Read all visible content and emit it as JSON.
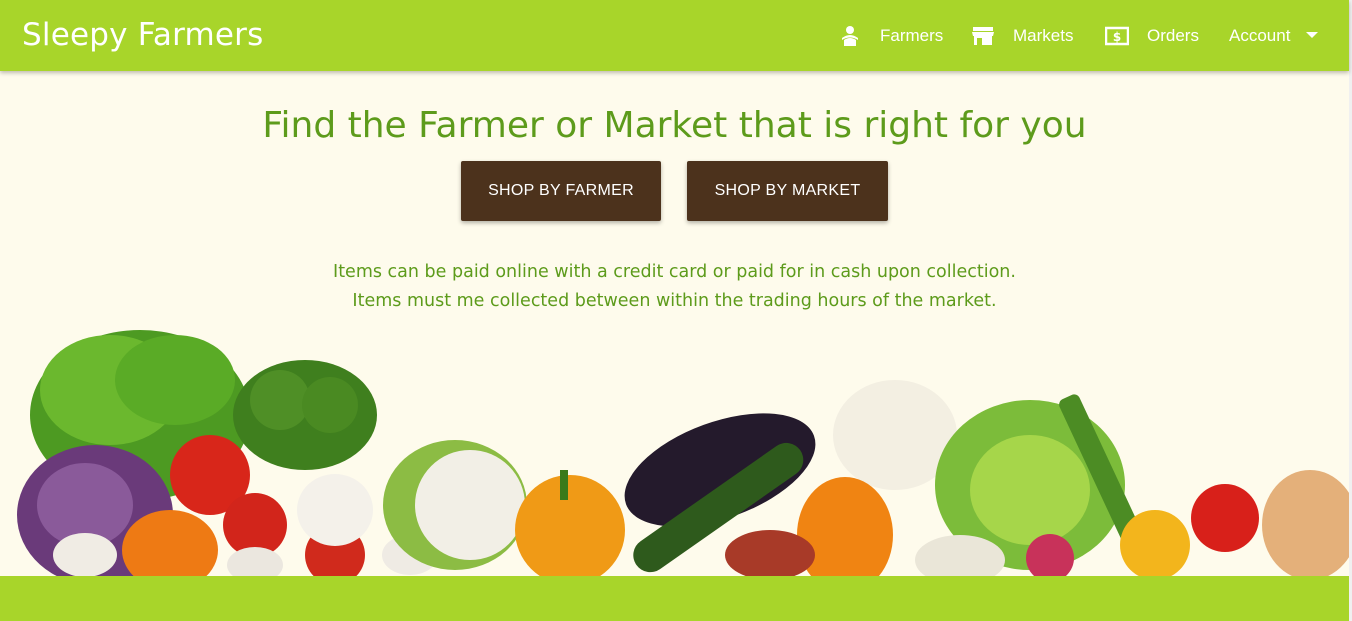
{
  "navbar": {
    "brand": "Sleepy Farmers",
    "items": [
      {
        "label": "Farmers",
        "icon": "farmer-icon"
      },
      {
        "label": "Markets",
        "icon": "store-icon"
      },
      {
        "label": "Orders",
        "icon": "money-icon"
      },
      {
        "label": "Account",
        "icon": "chevron-down-icon"
      }
    ]
  },
  "hero": {
    "title": "Find the Farmer or Market that is right for you",
    "shop_by_farmer": "SHOP BY FARMER",
    "shop_by_market": "SHOP BY MARKET"
  },
  "info": {
    "line1": "Items can be paid online with a credit card or paid for in cash upon collection.",
    "line2": "Items must me collected between within the trading hours of the market."
  },
  "colors": {
    "brand_green": "#a8d52a",
    "text_green": "#5d9b1b",
    "button_brown": "#4c321c",
    "background": "#fefbec"
  }
}
